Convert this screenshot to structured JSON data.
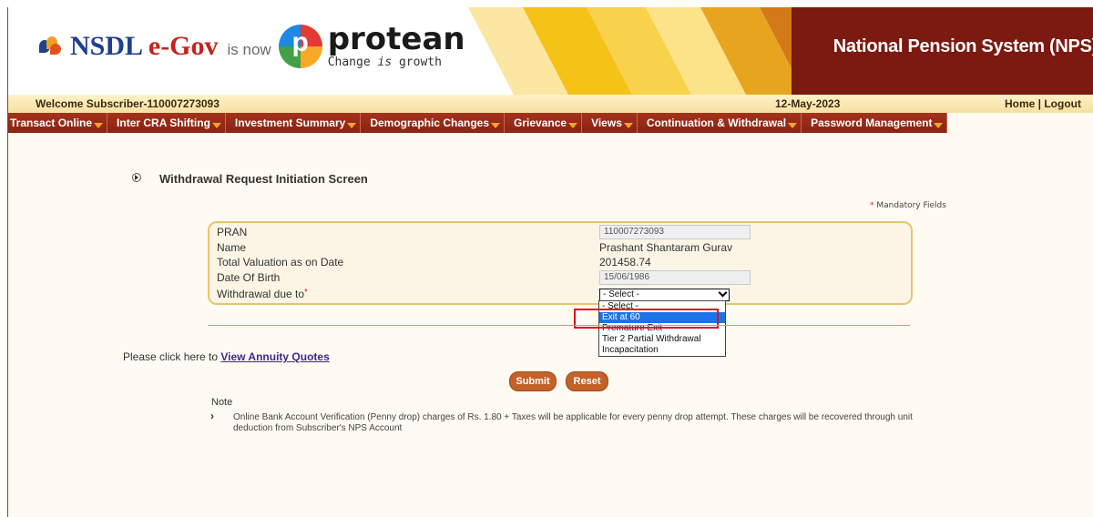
{
  "header": {
    "brand_nsdl": "NSDL",
    "brand_egov": "e-Gov",
    "is_now": "is now",
    "protean_word": "protean",
    "protean_tag_pre": "Change ",
    "protean_tag_is": "is",
    "protean_tag_post": " growth",
    "system_title": "National Pension System (NPS)"
  },
  "welcome": {
    "text": "Welcome Subscriber-110007273093",
    "date": "12-May-2023",
    "home": "Home",
    "separator": "|",
    "logout": "Logout"
  },
  "nav": {
    "items": [
      "Transact Online",
      "Inter CRA Shifting",
      "Investment Summary",
      "Demographic Changes",
      "Grievance",
      "Views",
      "Continuation & Withdrawal",
      "Password Management"
    ]
  },
  "page": {
    "title": "Withdrawal Request Initiation Screen",
    "mandatory_star": "*",
    "mandatory_text": " Mandatory Fields"
  },
  "form": {
    "pran_label": "PRAN",
    "pran_value": "110007273093",
    "name_label": "Name",
    "name_value": "Prashant Shantaram Gurav",
    "valuation_label": "Total Valuation as on Date",
    "valuation_value": "201458.74",
    "dob_label": "Date Of Birth",
    "dob_value": "15/06/1986",
    "withdrawal_label": "Withdrawal due to",
    "withdrawal_required": "*",
    "withdrawal_selected": "- Select -",
    "withdrawal_options": [
      "- Select -",
      "Exit at 60",
      "Premature Exit",
      "Tier 2 Partial Withdrawal",
      "Incapacitation"
    ],
    "highlighted_option": "Exit at 60"
  },
  "annuity": {
    "prefix": "Please click here to ",
    "link": "View Annuity Quotes"
  },
  "buttons": {
    "submit": "Submit",
    "reset": "Reset"
  },
  "note": {
    "title": "Note",
    "arrow": "›",
    "text": "Online Bank Account Verification (Penny drop) charges of Rs. 1.80 + Taxes will be applicable for every penny drop attempt. These charges will be recovered through unit deduction from Subscriber's NPS Account"
  },
  "colors": {
    "nav_bg": "#9b2c17",
    "accent_orange": "#c4612a",
    "banner_dark": "#7a1a10",
    "highlight_red": "#e0101a"
  }
}
